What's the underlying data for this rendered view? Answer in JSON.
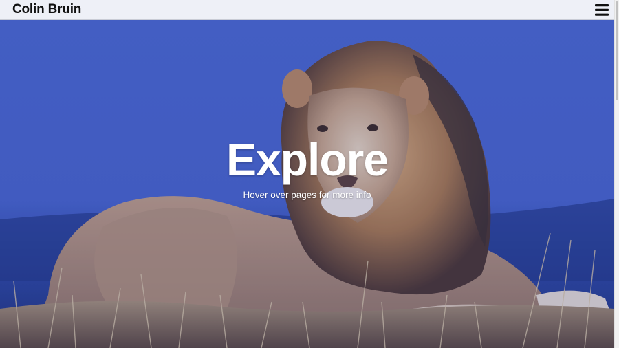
{
  "navbar": {
    "brand": "Colin Bruin",
    "menu_icon": "hamburger-menu-icon"
  },
  "hero": {
    "title": "Explore",
    "subtitle": "Hover over pages for more info",
    "background_image": "lion lying in grass",
    "overlay_color": "#2846c8"
  },
  "colors": {
    "navbar_bg": "#eef0f7",
    "sky": "#4f68c4",
    "text": "#ffffff"
  }
}
